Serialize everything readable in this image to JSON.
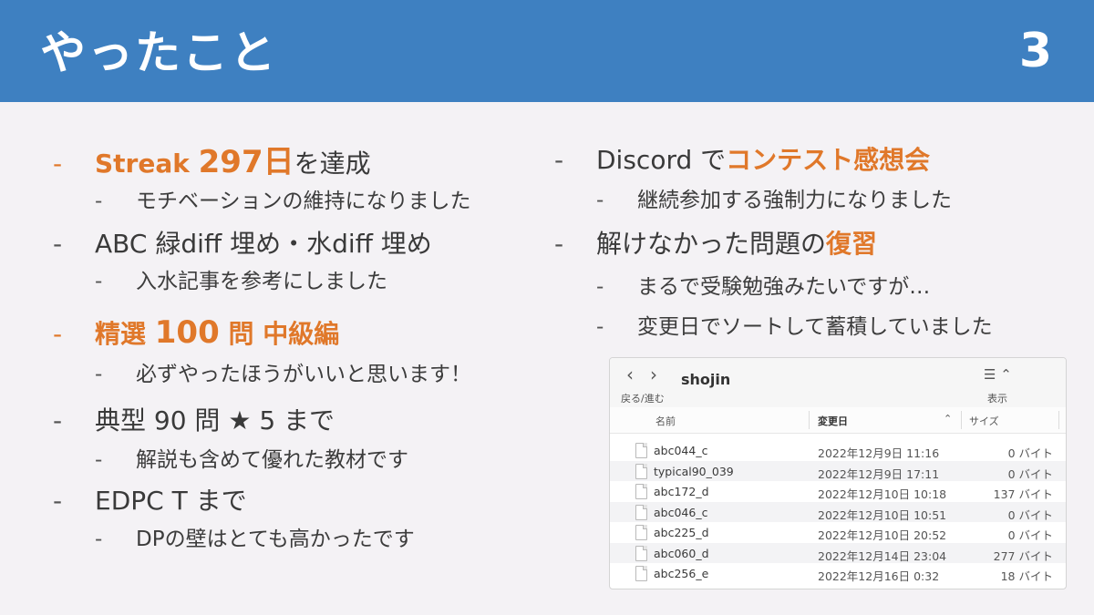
{
  "header": {
    "title": "やったこと",
    "page_number": "3"
  },
  "left": [
    {
      "parts": [
        {
          "t": "Streak ",
          "hl": true
        },
        {
          "t": "297日",
          "hl": true,
          "big": true
        },
        {
          "t": "を達成"
        }
      ],
      "accent": true,
      "subs": [
        "モチベーションの維持になりました"
      ]
    },
    {
      "parts": [
        {
          "t": "ABC 緑diff 埋め・水diff 埋め"
        }
      ],
      "subs": [
        "入水記事を参考にしました"
      ]
    },
    {
      "parts": [
        {
          "t": "精選 ",
          "hl": true
        },
        {
          "t": "100",
          "hl": true,
          "big": true
        },
        {
          "t": " 問 中級編",
          "hl": true
        }
      ],
      "accent": true,
      "subs": [
        "必ずやったほうがいいと思います！"
      ]
    },
    {
      "parts": [
        {
          "t": "典型 90 問 ★ 5 まで"
        }
      ],
      "subs": [
        "解説も含めて優れた教材です"
      ]
    },
    {
      "parts": [
        {
          "t": "EDPC T まで"
        }
      ],
      "subs": [
        "DPの壁はとても高かったです"
      ]
    }
  ],
  "right": [
    {
      "parts": [
        {
          "t": "Discord で"
        },
        {
          "t": "コンテスト感想会",
          "hl": true
        }
      ],
      "subs": [
        "継続参加する強制力になりました"
      ]
    },
    {
      "parts": [
        {
          "t": "解けなかった問題の"
        },
        {
          "t": "復習",
          "hl": true
        }
      ],
      "subs": [
        "まるで受験勉強みたいですが…",
        "変更日でソートして蓄積していました"
      ]
    }
  ],
  "finder": {
    "folder_name": "shojin",
    "nav_label": "戻る/進む",
    "view_label": "表示",
    "columns": {
      "name": "名前",
      "date": "変更日",
      "size": "サイズ"
    },
    "files": [
      {
        "name": "abc044_c",
        "date": "2022年12月9日 11:16",
        "size": "0 バイト"
      },
      {
        "name": "typical90_039",
        "date": "2022年12月9日 17:11",
        "size": "0 バイト"
      },
      {
        "name": "abc172_d",
        "date": "2022年12月10日 10:18",
        "size": "137 バイト"
      },
      {
        "name": "abc046_c",
        "date": "2022年12月10日 10:51",
        "size": "0 バイト"
      },
      {
        "name": "abc225_d",
        "date": "2022年12月10日 20:52",
        "size": "0 バイト"
      },
      {
        "name": "abc060_d",
        "date": "2022年12月14日 23:04",
        "size": "277 バイト"
      },
      {
        "name": "abc256_e",
        "date": "2022年12月16日 0:32",
        "size": "18 バイト"
      }
    ]
  },
  "colors": {
    "header": "#3e80c1",
    "accent": "#e0782a",
    "background": "#f4f2f5"
  }
}
